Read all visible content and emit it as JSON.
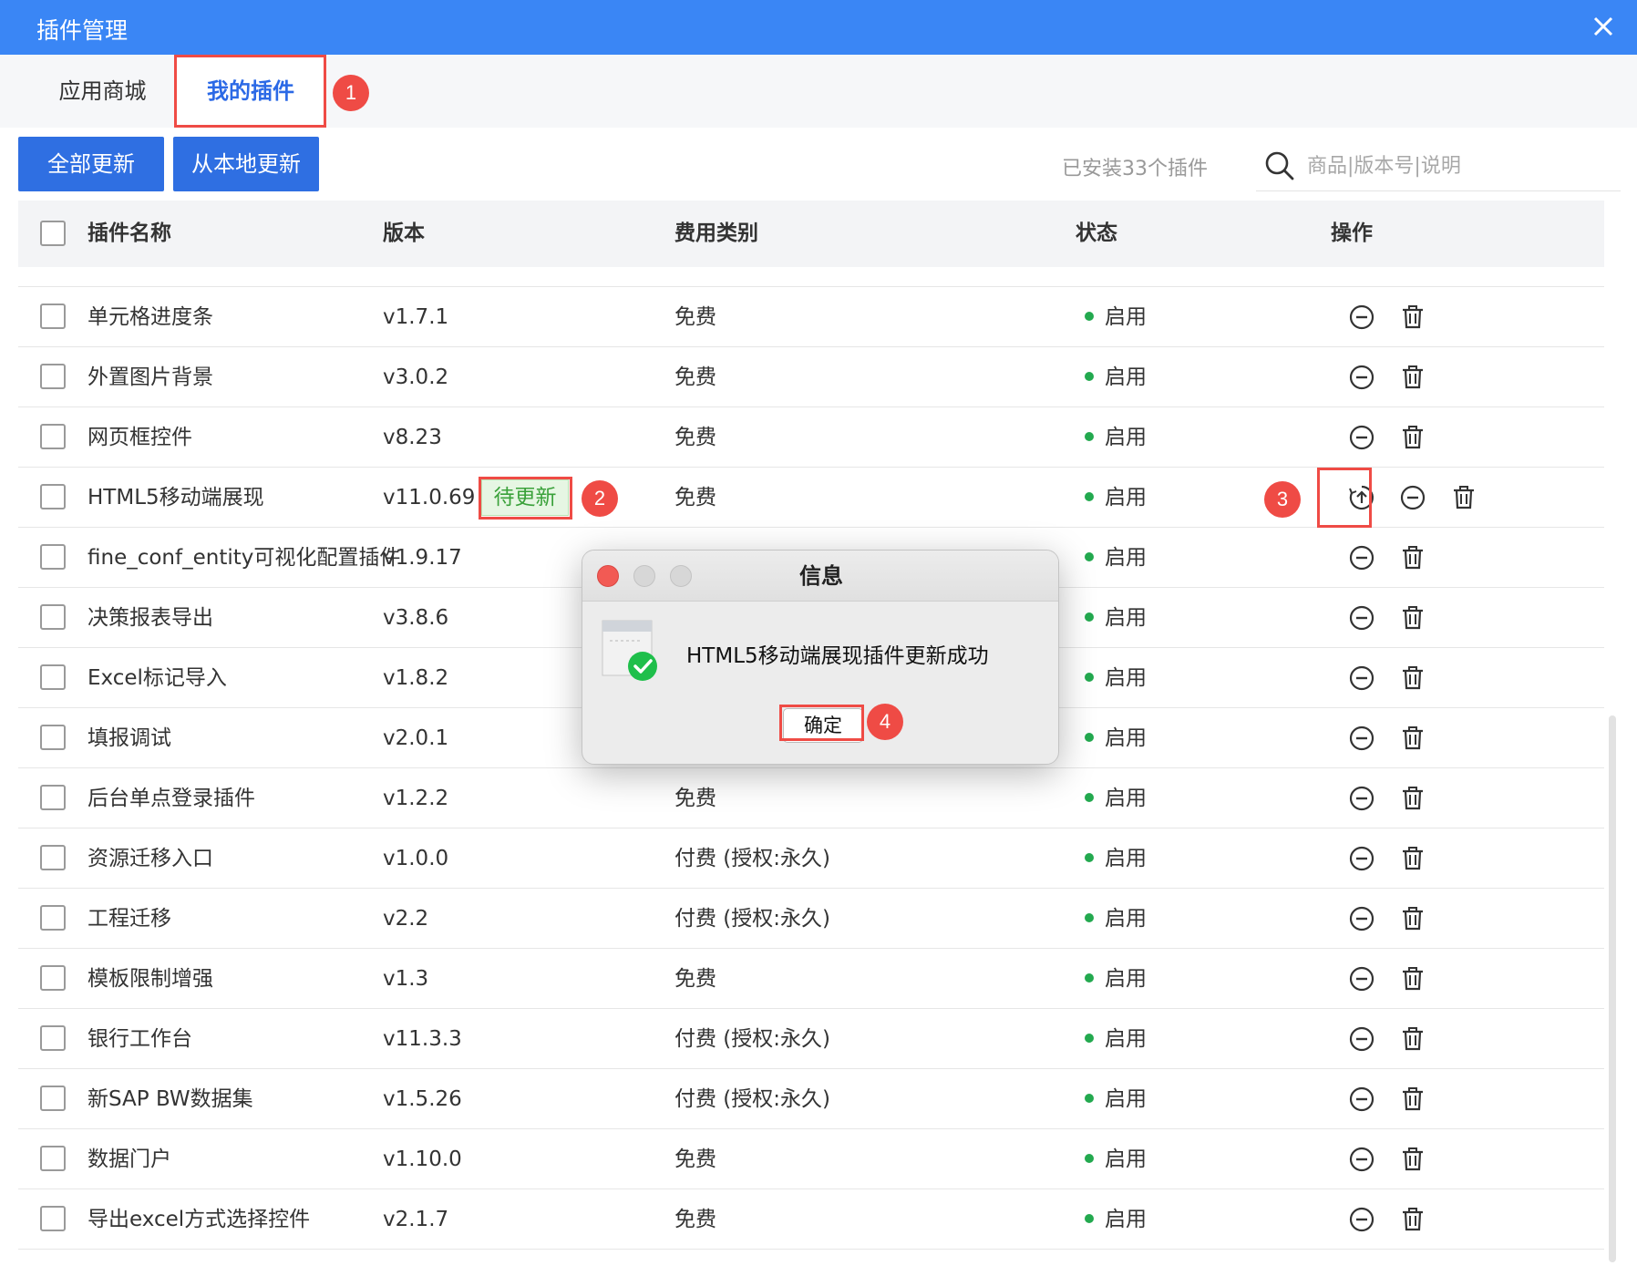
{
  "window": {
    "title": "插件管理",
    "close_icon": "close-icon"
  },
  "tabs": [
    {
      "label": "应用商城",
      "active": false
    },
    {
      "label": "我的插件",
      "active": true
    }
  ],
  "annotations": [
    "1",
    "2",
    "3",
    "4"
  ],
  "toolbar": {
    "update_all_label": "全部更新",
    "update_local_label": "从本地更新",
    "installed_count": "已安装33个插件",
    "search_placeholder": "商品|版本号|说明"
  },
  "table": {
    "columns": [
      "插件名称",
      "版本",
      "费用类别",
      "状态",
      "操作"
    ],
    "rows": [
      {
        "name": "单元格进度条",
        "version": "v1.7.1",
        "fee": "免费",
        "status": "启用"
      },
      {
        "name": "外置图片背景",
        "version": "v3.0.2",
        "fee": "免费",
        "status": "启用"
      },
      {
        "name": "网页框控件",
        "version": "v8.23",
        "fee": "免费",
        "status": "启用"
      },
      {
        "name": "HTML5移动端展现",
        "version": "v11.0.69",
        "fee": "免费",
        "status": "启用",
        "pending": "待更新"
      },
      {
        "name": "fine_conf_entity可视化配置插件",
        "version": "v1.9.17",
        "fee": "",
        "status": "启用"
      },
      {
        "name": "决策报表导出",
        "version": "v3.8.6",
        "fee": "",
        "status": "启用"
      },
      {
        "name": "Excel标记导入",
        "version": "v1.8.2",
        "fee": "",
        "status": "启用"
      },
      {
        "name": "填报调试",
        "version": "v2.0.1",
        "fee": "",
        "status": "启用"
      },
      {
        "name": "后台单点登录插件",
        "version": "v1.2.2",
        "fee": "免费",
        "status": "启用"
      },
      {
        "name": "资源迁移入口",
        "version": "v1.0.0",
        "fee": "付费 (授权:永久)",
        "status": "启用"
      },
      {
        "name": "工程迁移",
        "version": "v2.2",
        "fee": "付费 (授权:永久)",
        "status": "启用"
      },
      {
        "name": "模板限制增强",
        "version": "v1.3",
        "fee": "免费",
        "status": "启用"
      },
      {
        "name": "银行工作台",
        "version": "v11.3.3",
        "fee": "付费 (授权:永久)",
        "status": "启用"
      },
      {
        "name": "新SAP BW数据集",
        "version": "v1.5.26",
        "fee": "付费 (授权:永久)",
        "status": "启用"
      },
      {
        "name": "数据门户",
        "version": "v1.10.0",
        "fee": "免费",
        "status": "启用"
      },
      {
        "name": "导出excel方式选择控件",
        "version": "v2.1.7",
        "fee": "免费",
        "status": "启用"
      }
    ]
  },
  "dialog": {
    "title": "信息",
    "message": "HTML5移动端展现插件更新成功",
    "ok_label": "确定"
  },
  "colors": {
    "title_bar": "#3a86f5",
    "primary_button": "#2f6fe2",
    "status_dot": "#23a94f",
    "annotation": "#ef4b45",
    "pending_bg": "#e6f6e3",
    "pending_text": "#3aa13a"
  }
}
